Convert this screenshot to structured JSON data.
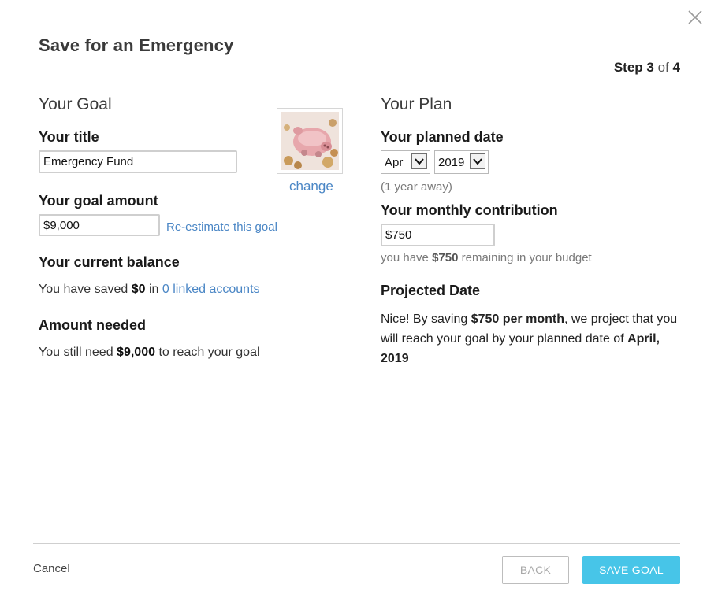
{
  "dialog": {
    "title": "Save for an Emergency",
    "step": {
      "prefix": "Step",
      "current": "3",
      "of": "of",
      "total": "4"
    },
    "close_icon": "close-icon"
  },
  "goal": {
    "heading": "Your Goal",
    "title_label": "Your title",
    "title_value": "Emergency Fund",
    "image_icon": "piggy-bank-image",
    "change_link": "change",
    "amount_label": "Your goal amount",
    "amount_value": "$9,000",
    "reestimate_link": "Re-estimate this goal",
    "balance_label": "Your current balance",
    "balance_prefix": "You have saved",
    "balance_amount": "$0",
    "balance_in": "in",
    "linked_accounts_link": "0 linked accounts",
    "needed_label": "Amount needed",
    "needed_prefix": "You still need",
    "needed_amount": "$9,000",
    "needed_suffix": "to reach your goal"
  },
  "plan": {
    "heading": "Your Plan",
    "date_label": "Your planned date",
    "month_value": "Apr",
    "year_value": "2019",
    "away_text": "(1 year away)",
    "contribution_label": "Your monthly contribution",
    "contribution_value": "$750",
    "budget_prefix": "you have",
    "budget_amount": "$750",
    "budget_suffix": "remaining in your budget",
    "projected_label": "Projected Date",
    "projected_prefix": "Nice! By saving",
    "projected_rate": "$750 per month",
    "projected_middle": ", we project that you will reach your goal by your planned date of",
    "projected_date": "April, 2019"
  },
  "footer": {
    "cancel": "Cancel",
    "back": "BACK",
    "save": "SAVE GOAL"
  },
  "colors": {
    "accent": "#47c5e8",
    "link": "#4a86c5"
  }
}
